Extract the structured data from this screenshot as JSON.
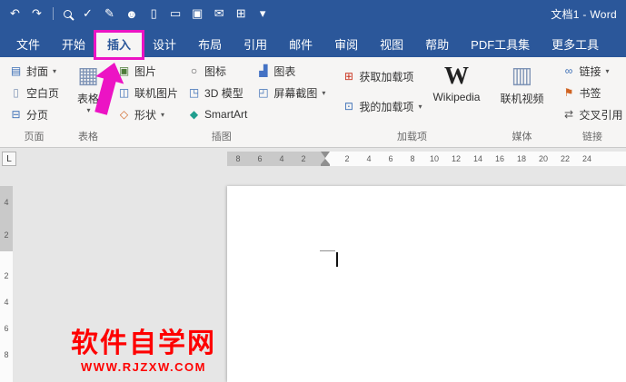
{
  "window": {
    "title": "文档1 - Word"
  },
  "titlebar": {
    "icons": {
      "undo": "↶",
      "redo": "↷",
      "spellcheck": "✓",
      "edit": "✎",
      "contacts": "☻",
      "new_doc": "▯",
      "open": "▭",
      "save": "▣",
      "email": "✉",
      "package": "⊞",
      "more": "▾"
    }
  },
  "tabs": [
    {
      "label": "文件"
    },
    {
      "label": "开始"
    },
    {
      "label": "插入",
      "active": true
    },
    {
      "label": "设计"
    },
    {
      "label": "布局"
    },
    {
      "label": "引用"
    },
    {
      "label": "邮件"
    },
    {
      "label": "审阅"
    },
    {
      "label": "视图"
    },
    {
      "label": "帮助"
    },
    {
      "label": "PDF工具集"
    },
    {
      "label": "更多工具"
    }
  ],
  "ribbon": {
    "groups": [
      {
        "label": "页面",
        "buttons": [
          {
            "label": "封面",
            "glyph": "▤",
            "dropdown": "▾"
          },
          {
            "label": "空白页",
            "glyph": "▯"
          },
          {
            "label": "分页",
            "glyph": "⊟"
          }
        ]
      },
      {
        "label": "表格",
        "button": {
          "label": "表格",
          "glyph": "▦",
          "dropdown": "▾"
        }
      },
      {
        "label": "插图",
        "buttons": [
          {
            "label": "图片",
            "glyph": "▣"
          },
          {
            "label": "联机图片",
            "glyph": "◫"
          },
          {
            "label": "形状",
            "glyph": "◇",
            "dropdown": "▾"
          },
          {
            "label": "图标",
            "glyph": "○"
          },
          {
            "label": "3D 模型",
            "glyph": "◳"
          },
          {
            "label": "SmartArt",
            "glyph": "◆"
          },
          {
            "label": "图表",
            "glyph": "▟"
          },
          {
            "label": "屏幕截图",
            "glyph": "◰",
            "dropdown": "▾"
          }
        ]
      },
      {
        "label": "加载项",
        "buttons": [
          {
            "label": "获取加载项",
            "glyph": "⊞"
          },
          {
            "label": "我的加载项",
            "glyph": "⊡",
            "dropdown": "▾"
          }
        ],
        "big": {
          "label": "Wikipedia",
          "glyph": "W"
        }
      },
      {
        "label": "媒体",
        "big": {
          "label": "联机视频",
          "glyph": "▥"
        }
      },
      {
        "label": "链接",
        "buttons": [
          {
            "label": "链接",
            "glyph": "∞",
            "dropdown": "▾"
          },
          {
            "label": "书签",
            "glyph": "⚑"
          },
          {
            "label": "交叉引用",
            "glyph": "⇄"
          }
        ]
      }
    ]
  },
  "ruler": {
    "tab_selector": "L",
    "h_margin_numbers": [
      "8",
      "6",
      "4",
      "2"
    ],
    "h_numbers": [
      "2",
      "4",
      "6",
      "8",
      "10",
      "12",
      "14",
      "16",
      "18",
      "20",
      "22",
      "24"
    ],
    "v_margin_numbers": [
      "4",
      "2"
    ],
    "v_numbers": [
      "2",
      "4",
      "6",
      "8"
    ]
  },
  "watermark": {
    "line1": "软件自学网",
    "line2": "WWW.RJZXW.COM"
  },
  "colors": {
    "titlebar_blue": "#2b579a",
    "annotation_pink": "#ec13c4",
    "watermark_red": "#fe0000",
    "ribbon_bg": "#f6f5f4"
  }
}
